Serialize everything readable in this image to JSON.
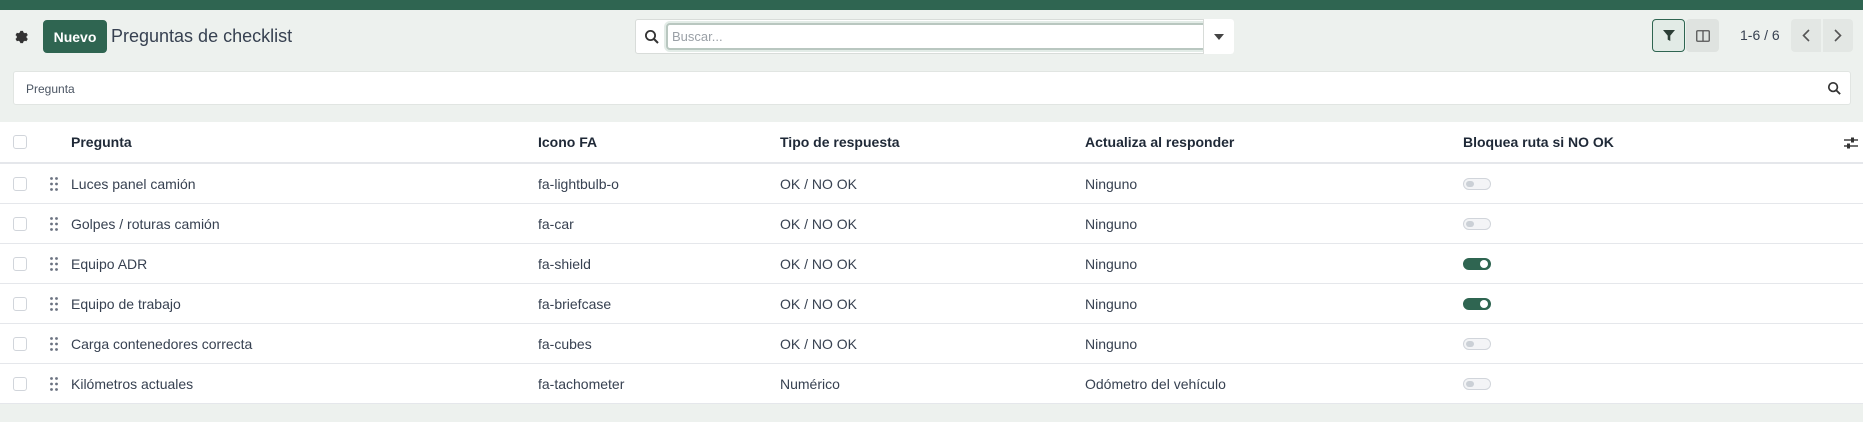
{
  "toolbar": {
    "new_label": "Nuevo",
    "title": "Preguntas de checklist",
    "search_placeholder": "Buscar...",
    "pager": "1-6 / 6"
  },
  "column_search": {
    "placeholder": "Pregunta"
  },
  "table": {
    "headers": {
      "pregunta": "Pregunta",
      "icono": "Icono FA",
      "tipo": "Tipo de respuesta",
      "actualiza": "Actualiza al responder",
      "bloquea": "Bloquea ruta si NO OK"
    },
    "rows": [
      {
        "pregunta": "Luces panel camión",
        "icono": "fa-lightbulb-o",
        "tipo": "OK / NO OK",
        "actualiza": "Ninguno",
        "bloquea": false
      },
      {
        "pregunta": "Golpes / roturas camión",
        "icono": "fa-car",
        "tipo": "OK / NO OK",
        "actualiza": "Ninguno",
        "bloquea": false
      },
      {
        "pregunta": "Equipo ADR",
        "icono": "fa-shield",
        "tipo": "OK / NO OK",
        "actualiza": "Ninguno",
        "bloquea": true
      },
      {
        "pregunta": "Equipo de trabajo",
        "icono": "fa-briefcase",
        "tipo": "OK / NO OK",
        "actualiza": "Ninguno",
        "bloquea": true
      },
      {
        "pregunta": "Carga contenedores correcta",
        "icono": "fa-cubes",
        "tipo": "OK / NO OK",
        "actualiza": "Ninguno",
        "bloquea": false
      },
      {
        "pregunta": "Kilómetros actuales",
        "icono": "fa-tachometer",
        "tipo": "Numérico",
        "actualiza": "Odómetro del vehículo",
        "bloquea": false
      }
    ]
  },
  "colors": {
    "brand": "#2f6551",
    "background": "#edf1ee"
  },
  "icons": [
    "gear-icon",
    "search-icon",
    "caret-down-icon",
    "filter-icon",
    "columns-icon",
    "chevron-left-icon",
    "chevron-right-icon",
    "drag-handle-icon",
    "optional-columns-icon"
  ]
}
